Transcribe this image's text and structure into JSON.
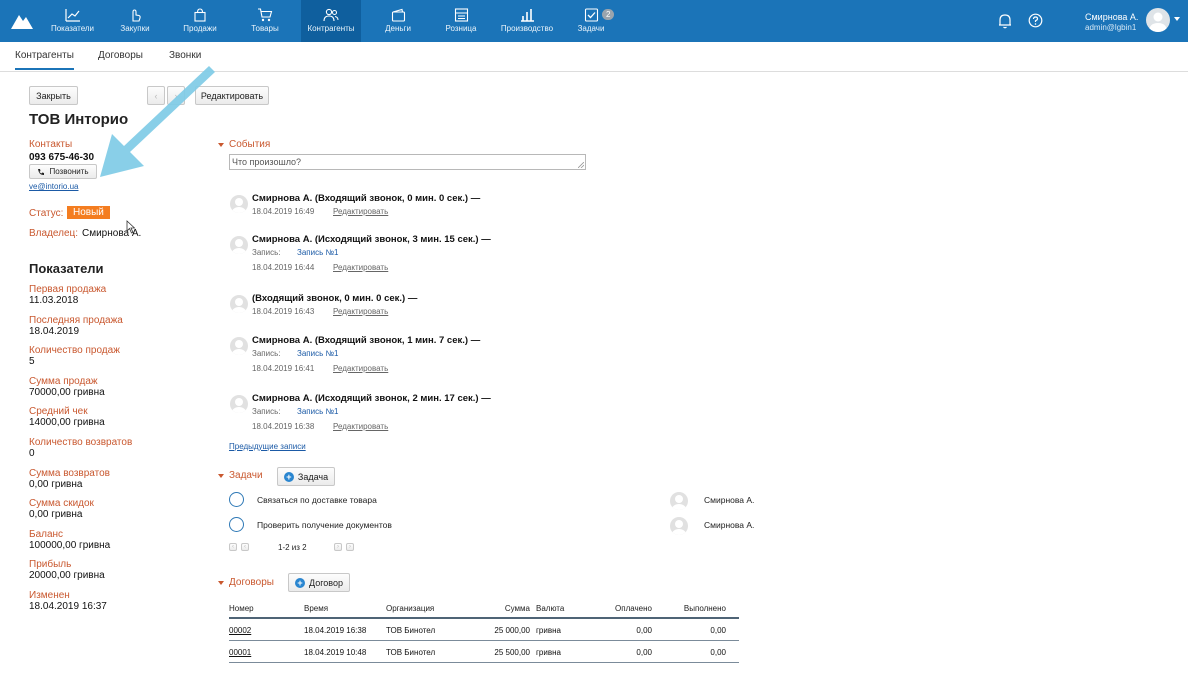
{
  "topnav": {
    "items": [
      {
        "label": "Показатели"
      },
      {
        "label": "Закупки"
      },
      {
        "label": "Продажи"
      },
      {
        "label": "Товары"
      },
      {
        "label": "Контрагенты"
      },
      {
        "label": "Деньги"
      },
      {
        "label": "Розница"
      },
      {
        "label": "Производство"
      },
      {
        "label": "Задачи"
      }
    ],
    "tasks_badge": "2",
    "user_name": "Смирнова А.",
    "user_email": "admin@lgbin1"
  },
  "subtabs": [
    "Контрагенты",
    "Договоры",
    "Звонки"
  ],
  "toolbar": {
    "close": "Закрыть",
    "edit": "Редактировать"
  },
  "company": {
    "name": "ТОВ Инторио",
    "contacts_label": "Контакты",
    "phone": "093 675-46-30",
    "call_button": "Позвонить",
    "email": "ve@intorio.ua",
    "status_label": "Статус:",
    "status": "Новый",
    "owner_label": "Владелец:",
    "owner": "Смирнова А."
  },
  "indicators": {
    "title": "Показатели",
    "items": [
      {
        "label": "Первая продажа",
        "value": "11.03.2018"
      },
      {
        "label": "Последняя продажа",
        "value": "18.04.2019"
      },
      {
        "label": "Количество продаж",
        "value": "5"
      },
      {
        "label": "Сумма продаж",
        "value": "70000,00 гривна"
      },
      {
        "label": "Средний чек",
        "value": "14000,00 гривна"
      },
      {
        "label": "Количество возвратов",
        "value": "0"
      },
      {
        "label": "Сумма возвратов",
        "value": "0,00 гривна"
      },
      {
        "label": "Сумма скидок",
        "value": "0,00 гривна"
      },
      {
        "label": "Баланс",
        "value": "100000,00 гривна"
      },
      {
        "label": "Прибыль",
        "value": "20000,00 гривна"
      },
      {
        "label": "Изменен",
        "value": "18.04.2019 16:37"
      }
    ]
  },
  "events": {
    "title": "События",
    "placeholder": "Что произошло?",
    "edit_label": "Редактировать",
    "record_label": "Запись:",
    "items": [
      {
        "title": "Смирнова А. (Входящий звонок, 0 мин. 0 сек.) —",
        "record": "",
        "time": "18.04.2019 16:49"
      },
      {
        "title": "Смирнова А. (Исходящий звонок, 3 мин. 15 сек.) —",
        "record": "Запись №1",
        "time": "18.04.2019 16:44"
      },
      {
        "title": "(Входящий звонок, 0 мин. 0 сек.) —",
        "record": "",
        "time": "18.04.2019 16:43"
      },
      {
        "title": "Смирнова А. (Входящий звонок, 1 мин. 7 сек.) —",
        "record": "Запись №1",
        "time": "18.04.2019 16:41"
      },
      {
        "title": "Смирнова А. (Исходящий звонок, 2 мин. 17 сек.) —",
        "record": "Запись №1",
        "time": "18.04.2019 16:38"
      }
    ],
    "prev_link": "Предыдущие записи"
  },
  "tasks": {
    "title": "Задачи",
    "add_button": "Задача",
    "items": [
      {
        "text": "Связаться по доставке товара",
        "assignee": "Смирнова А."
      },
      {
        "text": "Проверить получение документов",
        "assignee": "Смирнова А."
      }
    ],
    "pager": "1-2 из 2"
  },
  "contracts": {
    "title": "Договоры",
    "add_button": "Договор",
    "columns": [
      "Номер",
      "Время",
      "Организация",
      "Сумма",
      "Валюта",
      "Оплачено",
      "Выполнено"
    ],
    "rows": [
      [
        "00002",
        "18.04.2019 16:38",
        "ТОВ Бинотел",
        "25 000,00",
        "гривна",
        "0,00",
        "0,00"
      ],
      [
        "00001",
        "18.04.2019 10:48",
        "ТОВ Бинотел",
        "25 500,00",
        "гривна",
        "0,00",
        "0,00"
      ]
    ]
  },
  "colors": {
    "topbar": "#1b74b8",
    "accent_label": "#c9582f",
    "status_badge": "#f47d20",
    "overlay_arrow": "#7fcbe6"
  }
}
